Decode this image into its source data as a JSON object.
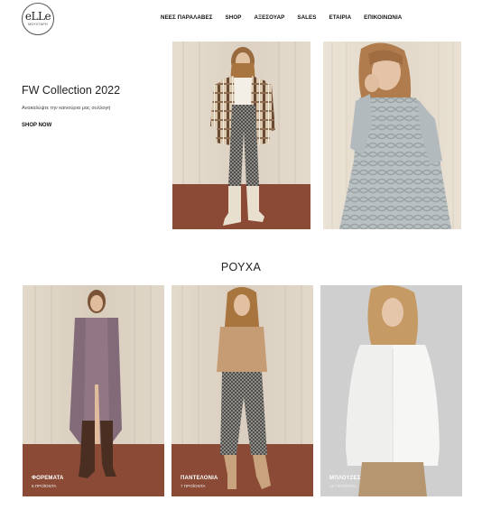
{
  "header": {
    "logo_text": "eLLe",
    "logo_sub": "ΜΟΥΧΤΑΡΗ",
    "nav": [
      {
        "label": "ΝΕΕΣ ΠΑΡΑΛΑΒΕΣ"
      },
      {
        "label": "SHOP"
      },
      {
        "label": "ΑΞΕΣΟΥΑΡ"
      },
      {
        "label": "SALES"
      },
      {
        "label": "ΕΤΑΙΡΙΑ"
      },
      {
        "label": "ΕΠΙΚΟΙΝΩΝΙΑ"
      }
    ]
  },
  "hero": {
    "title": "FW Collection 2022",
    "subtitle": "Ανακαλύψτε την καινούρια μας συλλογή",
    "cta": "SHOP NOW"
  },
  "section": {
    "heading": "ΡΟΥΧΑ"
  },
  "categories": [
    {
      "label": "ΦΟΡΕΜΑΤΑ",
      "count": "5 ΠΡΟΪΟΝΤΑ"
    },
    {
      "label": "ΠΑΝΤΕΛΟΝΙΑ",
      "count": "7 ΠΡΟΪΟΝΤΑ"
    },
    {
      "label": "ΜΠΛΟΥΖΕΣ",
      "count": "16 ΠΡΟΪΟΝΤΑ"
    }
  ],
  "colors": {
    "curtain": "#ddd3c5",
    "floor": "#8a4a35",
    "grey_backdrop": "#cfcfd0"
  }
}
